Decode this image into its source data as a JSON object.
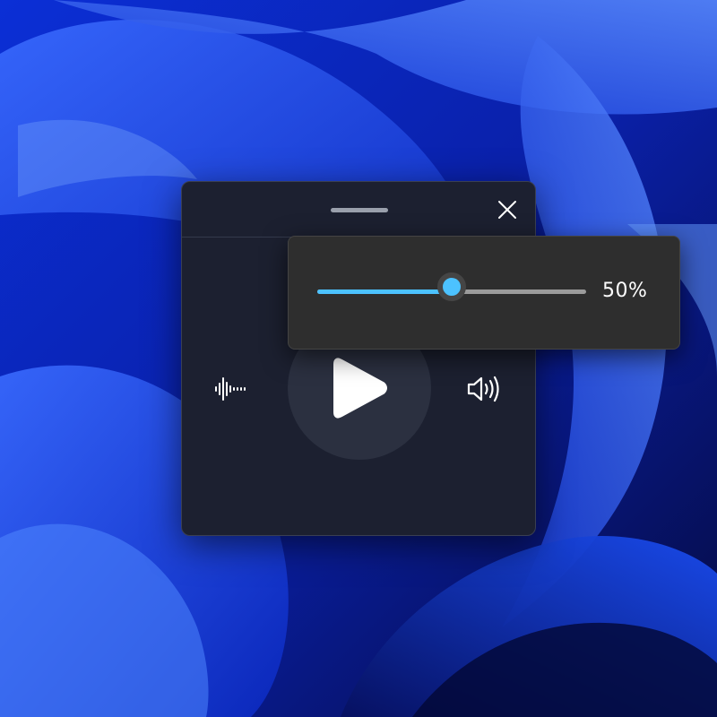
{
  "colors": {
    "accent": "#4cc2ff",
    "window_background": "#1c2030",
    "flyout_background": "#2e2e2e",
    "play_button_background": "#2b3040"
  },
  "player": {
    "icons": {
      "drag_handle": "drag-handle",
      "close": "close-icon",
      "waveform": "waveform-icon",
      "play": "play-icon",
      "volume": "speaker-volume-icon"
    }
  },
  "volume_flyout": {
    "volume_fraction": 0.5,
    "value_label": "50%"
  }
}
